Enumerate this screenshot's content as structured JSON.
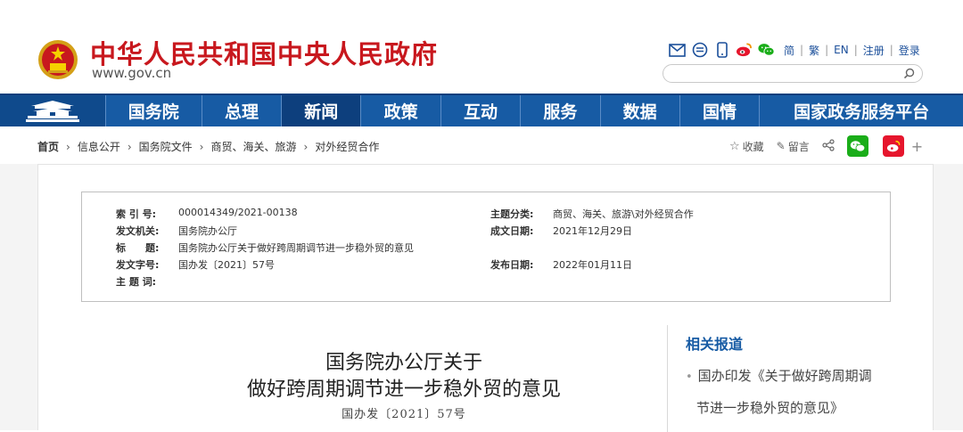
{
  "header": {
    "site_title": "中华人民共和国中央人民政府",
    "site_url": "www.gov.cn",
    "links": [
      "简",
      "繁",
      "EN",
      "注册",
      "登录"
    ],
    "icons": [
      "mail-icon",
      "chat-icon",
      "mobile-icon",
      "weibo-icon",
      "wechat-icon"
    ]
  },
  "nav": {
    "items": [
      "国务院",
      "总理",
      "新闻",
      "政策",
      "互动",
      "服务",
      "数据",
      "国情",
      "国家政务服务平台"
    ],
    "active_index": 2
  },
  "breadcrumb": {
    "items": [
      "首页",
      "信息公开",
      "国务院文件",
      "商贸、海关、旅游",
      "对外经贸合作"
    ]
  },
  "share": {
    "favorite": "收藏",
    "comment": "留言",
    "plus": "+"
  },
  "meta": {
    "index_label": "索 引 号:",
    "index_value": "000014349/2021-00138",
    "topic_label": "主题分类:",
    "topic_value": "商贸、海关、旅游\\对外经贸合作",
    "issuer_label": "发文机关:",
    "issuer_value": "国务院办公厅",
    "date_written_label": "成文日期:",
    "date_written_value": "2021年12月29日",
    "title_label": "标　　题:",
    "title_value": "国务院办公厅关于做好跨周期调节进一步稳外贸的意见",
    "doc_no_label": "发文字号:",
    "doc_no_value": "国办发〔2021〕57号",
    "pub_date_label": "发布日期:",
    "pub_date_value": "2022年01月11日",
    "keywords_label": "主 题 词:",
    "keywords_value": ""
  },
  "document": {
    "title_line1": "国务院办公厅关于",
    "title_line2": "做好跨周期调节进一步稳外贸的意见",
    "number": "国办发〔2021〕57号"
  },
  "sidebar": {
    "title": "相关报道",
    "item_line1": "国办印发《关于做好跨周期调",
    "item_line2": "节进一步稳外贸的意见》"
  },
  "colors": {
    "brand_red": "#c8181e",
    "nav_blue": "#175ba4",
    "wechat_green": "#1aad19",
    "weibo_orange": "#e6162d"
  }
}
